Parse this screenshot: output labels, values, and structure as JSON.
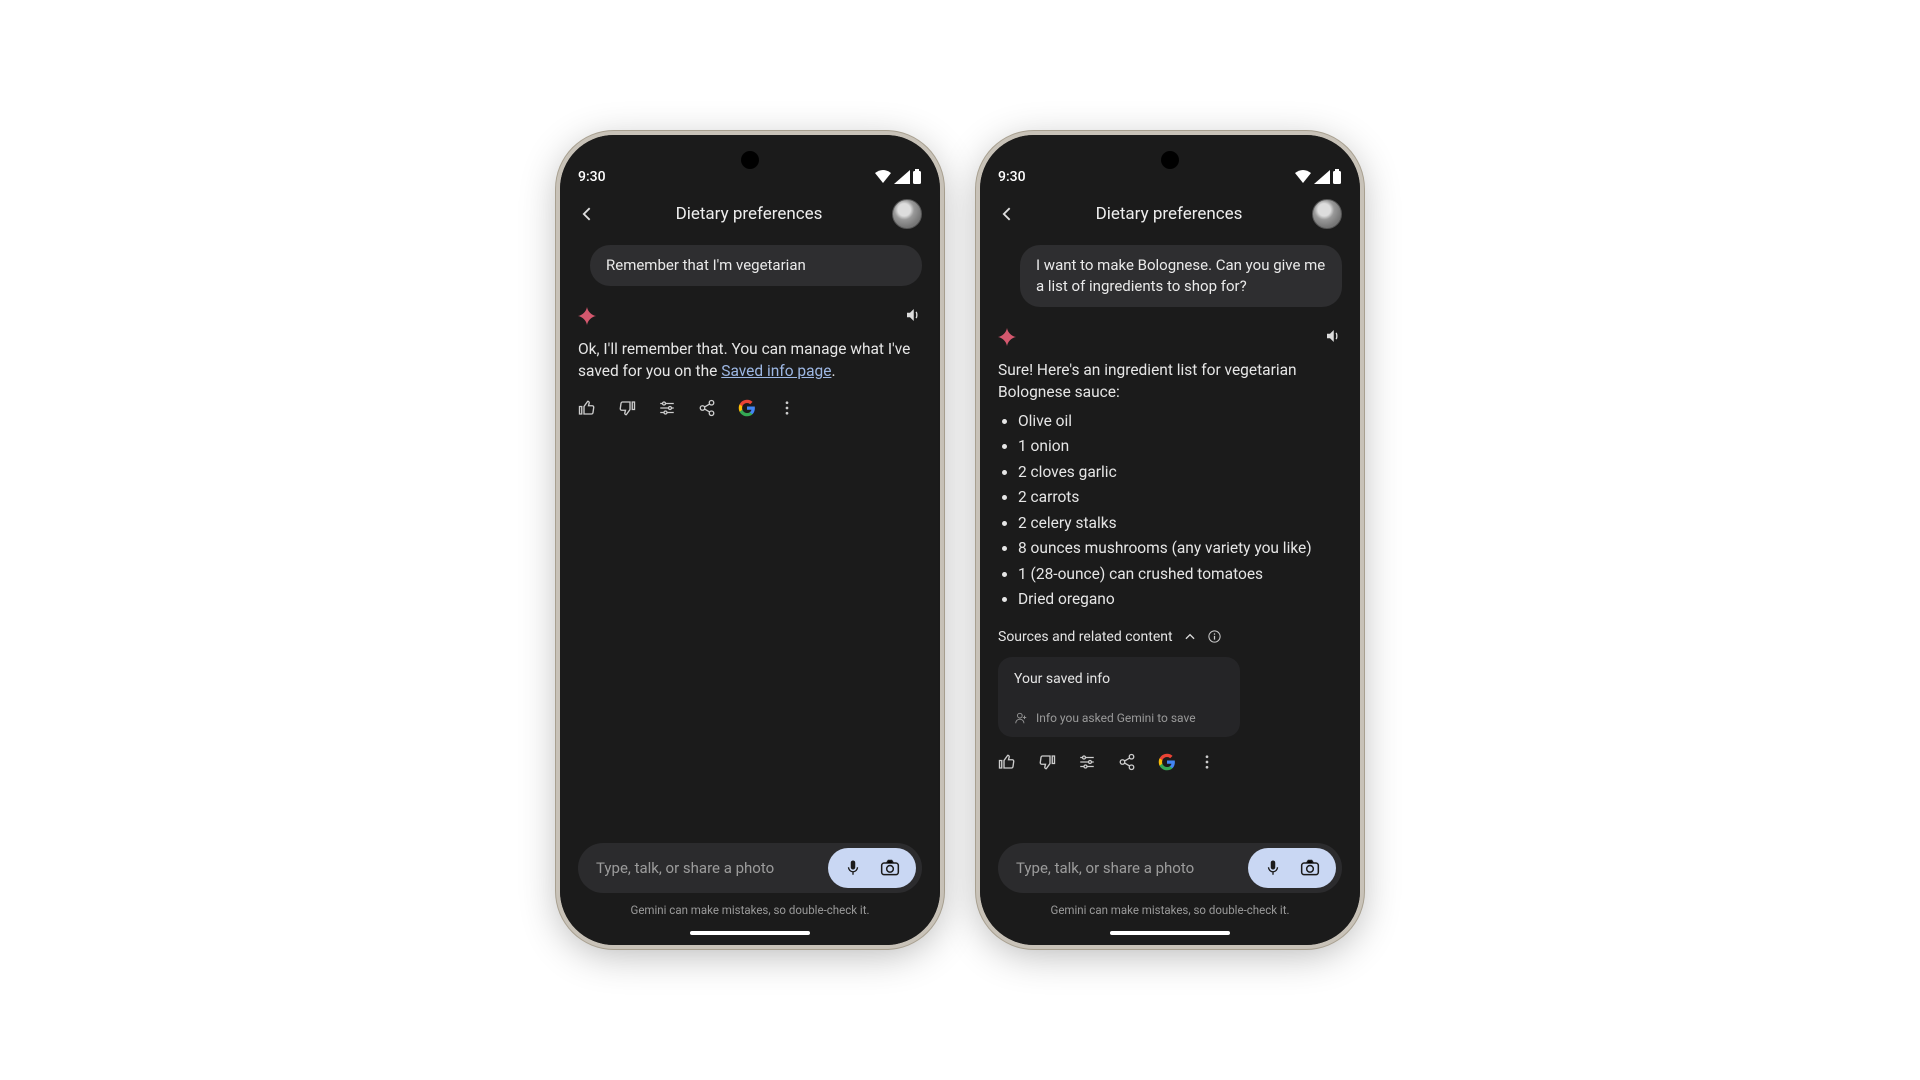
{
  "status_time": "9:30",
  "app_title": "Dietary preferences",
  "phone1": {
    "user_message": "Remember that I'm vegetarian",
    "assistant_pre": "Ok, I'll remember that. You can manage what I've saved for you on the ",
    "assistant_link": "Saved info page",
    "assistant_post": "."
  },
  "phone2": {
    "user_message": "I want to make Bolognese. Can you give me a list of ingredients to shop for?",
    "assistant_intro": "Sure! Here's an ingredient list for vegetarian Bolognese sauce:",
    "ingredients": [
      "Olive oil",
      "1 onion",
      "2 cloves garlic",
      "2 carrots",
      "2 celery stalks",
      "8 ounces mushrooms (any variety you like)",
      "1 (28-ounce) can crushed tomatoes",
      "Dried oregano"
    ],
    "sources_label": "Sources and related content",
    "saved_title": "Your saved info",
    "saved_sub": "Info you asked Gemini to save"
  },
  "input_placeholder": "Type, talk, or share a photo",
  "footer_note": "Gemini can make mistakes, so double-check it."
}
